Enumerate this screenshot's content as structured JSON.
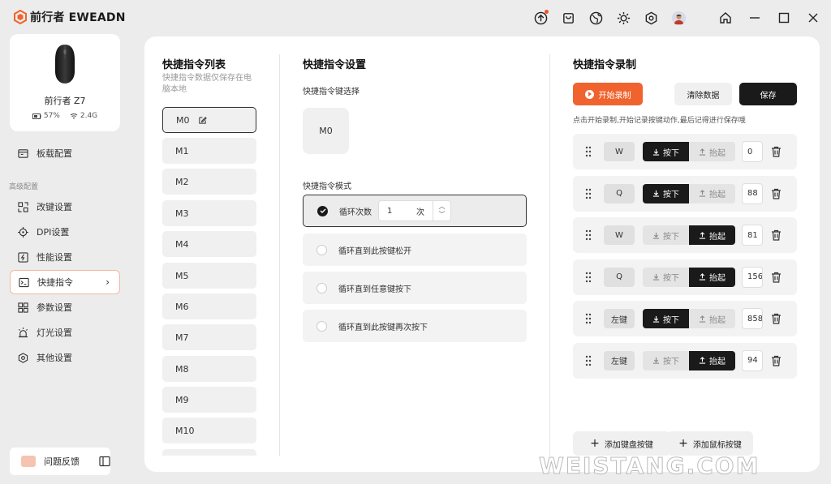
{
  "app": {
    "brand": "前行者 EWEADN"
  },
  "device": {
    "name": "前行者 Z7",
    "battery": "57%",
    "polling": "2.4G"
  },
  "sidebar": {
    "board_config": "板载配置",
    "section_advanced": "高级配置",
    "items": [
      {
        "label": "改键设置",
        "icon": "keymap-icon"
      },
      {
        "label": "DPI设置",
        "icon": "dpi-icon"
      },
      {
        "label": "性能设置",
        "icon": "performance-icon"
      },
      {
        "label": "快捷指令",
        "icon": "terminal-icon"
      },
      {
        "label": "参数设置",
        "icon": "grid-icon"
      },
      {
        "label": "灯光设置",
        "icon": "light-icon"
      },
      {
        "label": "其他设置",
        "icon": "settings-hex-icon"
      }
    ],
    "active_index": 3,
    "feedback": "问题反馈"
  },
  "macro_list": {
    "title": "快捷指令列表",
    "note_line1": "快捷指令数据仅保存在电",
    "note_line2": "脑本地",
    "items": [
      "M0",
      "M1",
      "M2",
      "M3",
      "M4",
      "M5",
      "M6",
      "M7",
      "M8",
      "M9",
      "M10"
    ],
    "selected": "M0"
  },
  "macro_settings": {
    "title": "快捷指令设置",
    "key_select_label": "快捷指令键选择",
    "key_value": "M0",
    "mode_label": "快捷指令模式",
    "modes": [
      {
        "label": "循环次数",
        "checked": true
      },
      {
        "label": "循环直到此按键松开",
        "checked": false
      },
      {
        "label": "循环直到任意键按下",
        "checked": false
      },
      {
        "label": "循环直到此按键再次按下",
        "checked": false
      }
    ],
    "loop_count": "1",
    "loop_unit": "次"
  },
  "recording": {
    "title": "快捷指令录制",
    "start_label": "开始录制",
    "clear_label": "清除数据",
    "save_label": "保存",
    "hint": "点击开始录制,开始记录按键动作,最后记得进行保存哦",
    "press_label": "按下",
    "release_label": "抬起",
    "rows": [
      {
        "key": "W",
        "action": "press",
        "delay": "0"
      },
      {
        "key": "Q",
        "action": "press",
        "delay": "88"
      },
      {
        "key": "W",
        "action": "release",
        "delay": "81"
      },
      {
        "key": "Q",
        "action": "release",
        "delay": "156"
      },
      {
        "key": "左键",
        "action": "press",
        "delay": "858"
      },
      {
        "key": "左键",
        "action": "release",
        "delay": "94"
      }
    ],
    "add_keyboard": "添加键盘按键",
    "add_mouse": "添加鼠标按键"
  },
  "colors": {
    "accent": "#f0632e",
    "dark": "#1a1a1a"
  },
  "watermark": "WEISTANG.COM"
}
